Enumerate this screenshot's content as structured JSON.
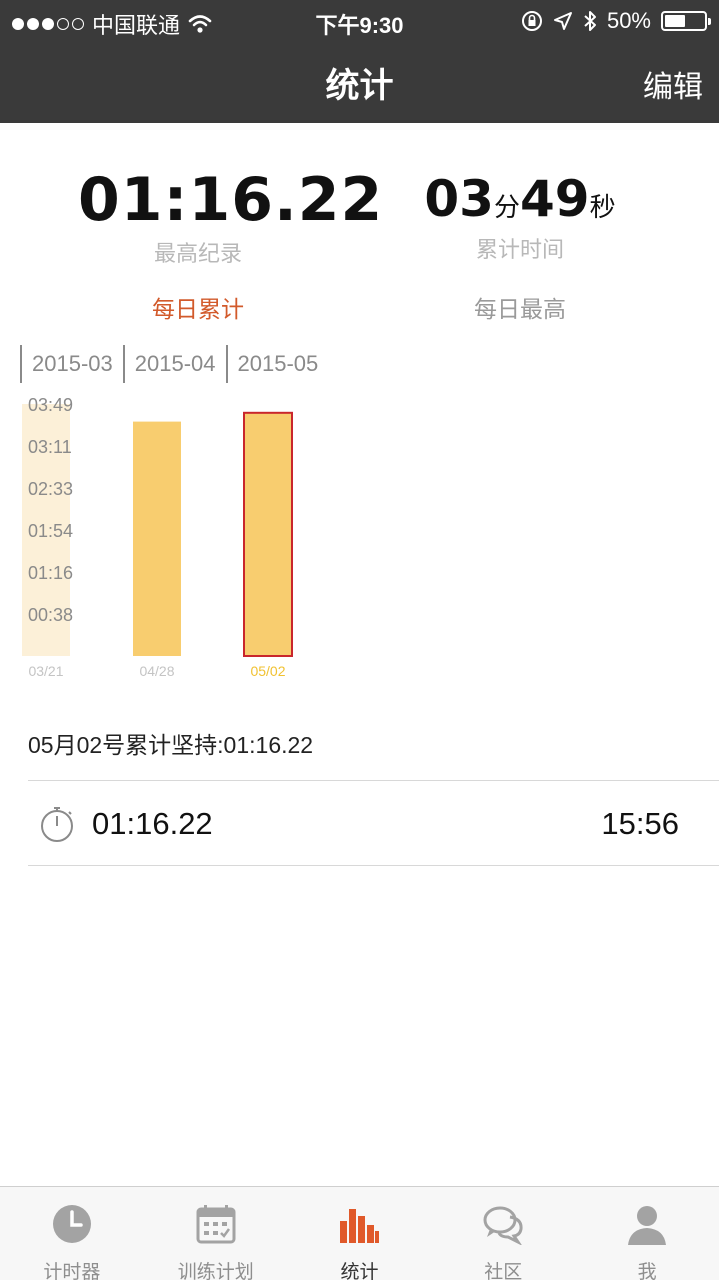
{
  "status_bar": {
    "carrier": "中国联通",
    "time": "下午9:30",
    "battery": "50%",
    "signal_dots": [
      true,
      true,
      true,
      false,
      false
    ]
  },
  "nav": {
    "title": "统计",
    "edit": "编辑"
  },
  "summary": {
    "best_record": "01:16.22",
    "best_label": "最高纪录",
    "total_minutes": "03",
    "total_minutes_unit": "分",
    "total_seconds": "49",
    "total_seconds_unit": "秒",
    "total_label": "累计时间"
  },
  "modes": {
    "daily_total": "每日累计",
    "daily_max": "每日最高",
    "selected": "daily_total"
  },
  "months": [
    "2015-03",
    "2015-04",
    "2015-05"
  ],
  "chart_data": {
    "type": "bar",
    "y_tick_labels": [
      "03:49",
      "03:11",
      "02:33",
      "01:54",
      "01:16",
      "00:38"
    ],
    "ylim_seconds": [
      0,
      229
    ],
    "categories": [
      "03/21",
      "04/28",
      "05/02"
    ],
    "values_seconds": [
      229,
      213,
      221
    ],
    "selected_index": 2,
    "colors": {
      "bar": "#f8cd6f",
      "first_bar": "#fcf0d8",
      "selected_border": "#c9262c",
      "selected_label": "#f1c232",
      "label": "#c4c4c4",
      "tick": "#8a8a8a"
    }
  },
  "detail": {
    "day_summary": "05月02号累计坚持:01:16.22",
    "records": [
      {
        "duration": "01:16.22",
        "time": "15:56"
      }
    ]
  },
  "tabbar": {
    "accent": "#e0592a",
    "inactive": "#a3a3a3",
    "tabs": [
      {
        "label": "计时器",
        "icon": "clock-icon"
      },
      {
        "label": "训练计划",
        "icon": "calendar-icon"
      },
      {
        "label": "统计",
        "icon": "bar-chart-icon",
        "active": true
      },
      {
        "label": "社区",
        "icon": "chat-bubbles-icon"
      },
      {
        "label": "我",
        "icon": "person-icon"
      }
    ]
  }
}
